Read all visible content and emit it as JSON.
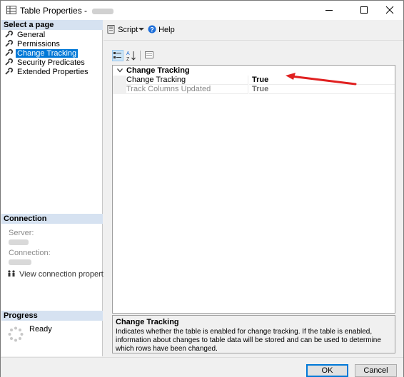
{
  "window": {
    "title": "Table Properties - ",
    "close_glyph": "✕",
    "minimize_glyph": "—"
  },
  "left_pane": {
    "select_page_header": "Select a page",
    "pages": [
      {
        "label": "General",
        "icon": "wrench-icon"
      },
      {
        "label": "Permissions",
        "icon": "wrench-icon"
      },
      {
        "label": "Change Tracking",
        "icon": "wrench-icon"
      },
      {
        "label": "Security Predicates",
        "icon": "wrench-icon"
      },
      {
        "label": "Extended Properties",
        "icon": "wrench-icon"
      }
    ],
    "selected_page": "Change Tracking",
    "connection_header": "Connection",
    "server_label": "Server:",
    "connection_label": "Connection:",
    "view_connection_link": "View connection properties",
    "progress_header": "Progress",
    "progress_status": "Ready"
  },
  "toolbar": {
    "script_label": "Script",
    "help_label": "Help"
  },
  "property_grid": {
    "category": "Change Tracking",
    "rows": [
      {
        "name": "Change Tracking",
        "value": "True",
        "enabled": true
      },
      {
        "name": "Track Columns Updated",
        "value": "True",
        "enabled": false
      }
    ]
  },
  "description": {
    "title": "Change Tracking",
    "text": "Indicates whether the table is enabled for change tracking. If the table is enabled, information about changes to table data will be stored and can be used to determine which rows have been changed."
  },
  "buttons": {
    "ok": "OK",
    "cancel": "Cancel"
  },
  "colors": {
    "selection": "#0078d7",
    "section_header": "#d6e2f1",
    "annotation_arrow": "#e02020"
  }
}
